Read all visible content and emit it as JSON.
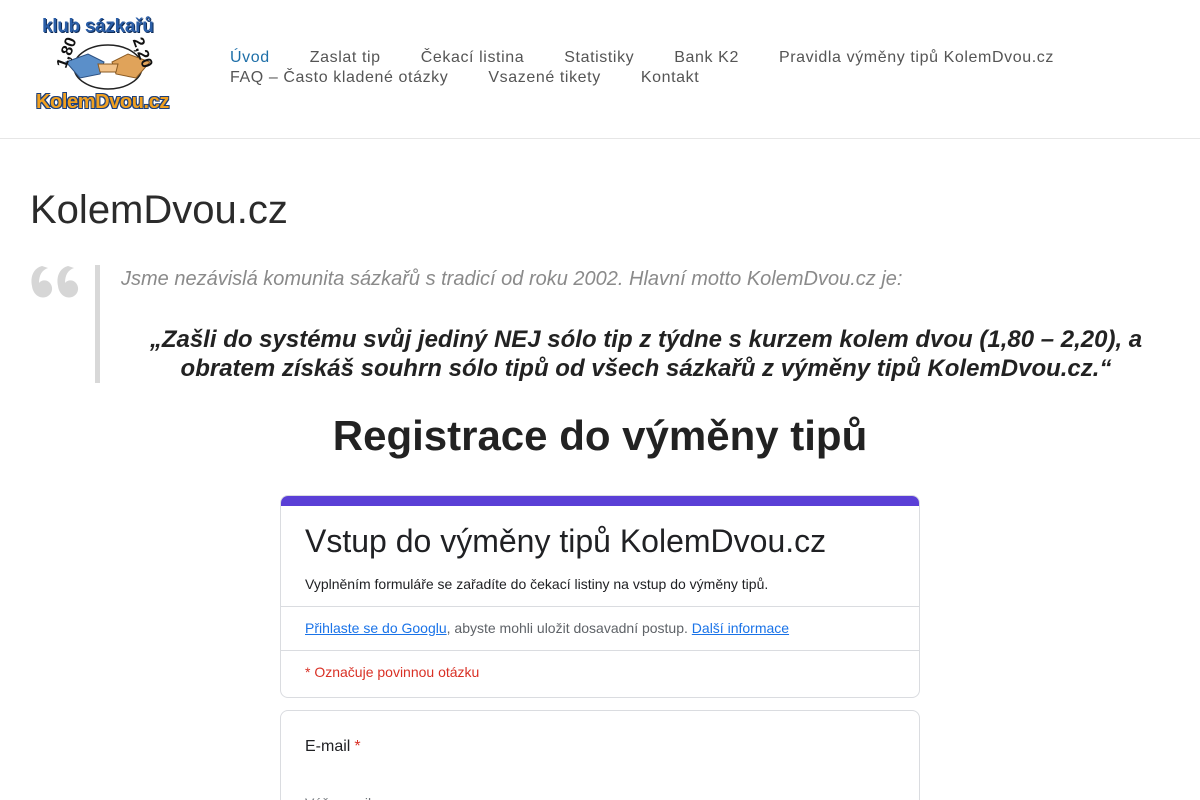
{
  "logo": {
    "top_text": "klub sázkařů",
    "bottom_text": "KolemDvou.cz",
    "odd_low": "1,80",
    "odd_high": "2,20"
  },
  "nav": {
    "row1": [
      "Úvod",
      "Zaslat tip",
      "Čekací listina",
      "Statistiky",
      "Bank K2",
      "Pravidla výměny tipů KolemDvou.cz"
    ],
    "row2": [
      "FAQ – Často kladené otázky",
      "Vsazené tikety",
      "Kontakt"
    ],
    "active": "Úvod"
  },
  "page": {
    "title": "KolemDvou.cz",
    "quote_intro": "Jsme nezávislá komunita sázkařů s tradicí od roku 2002. Hlavní motto KolemDvou.cz je:",
    "quote_motto": "„Zašli do systému svůj jediný NEJ sólo tip z týdne s kurzem kolem dvou (1,80 – 2,20), a obratem získáš souhrn sólo tipů od všech sázkařů z výměny tipů KolemDvou.cz.“",
    "registration_heading": "Registrace do výměny tipů"
  },
  "form": {
    "title": "Vstup do výměny tipů KolemDvou.cz",
    "description": "Vyplněním formuláře se zařadíte do čekací listiny na vstup do výměny tipů.",
    "signin_link": "Přihlaste se do Googlu",
    "signin_text": ", abyste mohli uložit dosavadní postup. ",
    "more_info_link": "Další informace",
    "required_note": "* Označuje povinnou otázku",
    "email_label": "E-mail",
    "required_mark": "*",
    "email_placeholder": "Váš e-mail"
  },
  "colors": {
    "accent": "#5a3fd6",
    "nav_active": "#1e6fa8",
    "required": "#d93025",
    "link": "#1a73e8"
  }
}
